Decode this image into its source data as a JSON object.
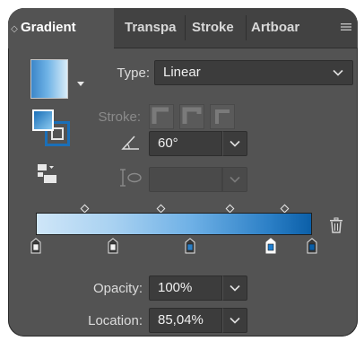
{
  "tabs": [
    {
      "label": "Gradient",
      "active": true
    },
    {
      "label": "Transpa",
      "active": false
    },
    {
      "label": "Stroke",
      "active": false
    },
    {
      "label": "Artboar",
      "active": false
    }
  ],
  "type": {
    "label": "Type:",
    "value": "Linear"
  },
  "stroke": {
    "label": "Stroke:"
  },
  "angle": {
    "value": "60°"
  },
  "aspect": {
    "value": ""
  },
  "opacity": {
    "label": "Opacity:",
    "value": "100%"
  },
  "location": {
    "label": "Location:",
    "value": "85,04%"
  },
  "colors": {
    "panel_bg": "#535353",
    "tab_bg": "#424242",
    "field_bg": "#3c3c3c",
    "accent": "#1a6fb8",
    "gradient_start": "#cfe6f8",
    "gradient_end": "#0b5fa8"
  },
  "gradient_stops": [
    {
      "location_percent": 0,
      "color": "#f2f2f2",
      "selected": false
    },
    {
      "location_percent": 28,
      "color": "#f2f2f2",
      "selected": false
    },
    {
      "location_percent": 56,
      "color": "#2b7fc6",
      "selected": false
    },
    {
      "location_percent": 85.04,
      "color": "#1f7fd0",
      "selected": true
    },
    {
      "location_percent": 100,
      "color": "#0b5fa8",
      "selected": false
    }
  ],
  "icons": [
    "options-menu-icon",
    "gradient-swatch",
    "fill-stroke-icon",
    "gradient-type-icon",
    "angle-icon",
    "aspect-ratio-icon",
    "delete-stop-icon"
  ]
}
